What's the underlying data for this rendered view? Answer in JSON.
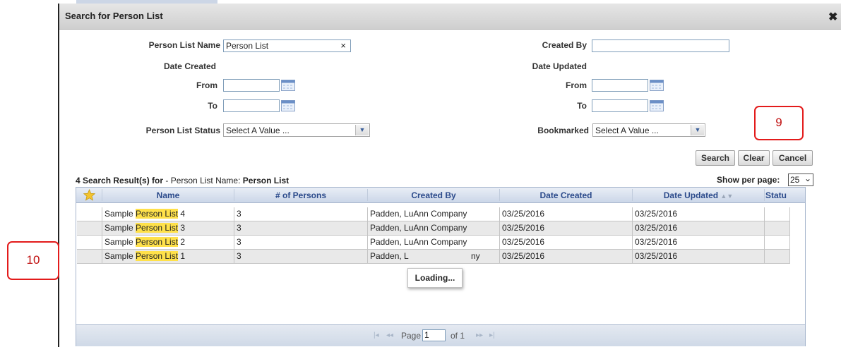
{
  "dialog": {
    "title": "Search for Person List",
    "close_glyph": "✖"
  },
  "form": {
    "person_list_name_label": "Person List Name",
    "person_list_name_value": "Person List",
    "clear_glyph": "×",
    "created_by_label": "Created By",
    "created_by_value": "",
    "date_created_label": "Date Created",
    "date_updated_label": "Date Updated",
    "from_label": "From",
    "to_label": "To",
    "status_label": "Person List Status",
    "status_value": "Select A Value ...",
    "bookmarked_label": "Bookmarked",
    "bookmarked_value": "Select A Value ..."
  },
  "buttons": {
    "search": "Search",
    "clear": "Clear",
    "cancel": "Cancel"
  },
  "results": {
    "summary_prefix": "4 Search Result(s) for",
    "summary_dash": " - Person List Name: ",
    "summary_term": "Person List",
    "show_per_page_label": "Show per page:",
    "show_per_page_value": "25"
  },
  "grid": {
    "columns": [
      "Name",
      "# of Persons",
      "Created By",
      "Date Created",
      "Date Updated",
      "Statu"
    ],
    "rows": [
      {
        "name_pre": "Sample ",
        "name_hl": "Person List",
        "name_post": " 4",
        "persons": "3",
        "created_by": "Padden, LuAnn Company",
        "date_created": "03/25/2016",
        "date_updated": "03/25/2016"
      },
      {
        "name_pre": "Sample ",
        "name_hl": "Person List",
        "name_post": " 3",
        "persons": "3",
        "created_by": "Padden, LuAnn Company",
        "date_created": "03/25/2016",
        "date_updated": "03/25/2016"
      },
      {
        "name_pre": "Sample ",
        "name_hl": "Person List",
        "name_post": " 2",
        "persons": "3",
        "created_by": "Padden, LuAnn Company",
        "date_created": "03/25/2016",
        "date_updated": "03/25/2016"
      },
      {
        "name_pre": "Sample ",
        "name_hl": "Person List",
        "name_post": " 1",
        "persons": "3",
        "created_by": "Padden, L",
        "created_by_tail": "ny",
        "date_created": "03/25/2016",
        "date_updated": "03/25/2016"
      }
    ],
    "loading": "Loading...",
    "pager": {
      "page_label": "Page",
      "page_value": "1",
      "of_label": "of 1"
    }
  },
  "callouts": {
    "c9": "9",
    "c10": "10"
  },
  "colors": {
    "callout": "#e31b1b",
    "highlight": "#ffe14a",
    "header_text": "#2b4a8b"
  }
}
